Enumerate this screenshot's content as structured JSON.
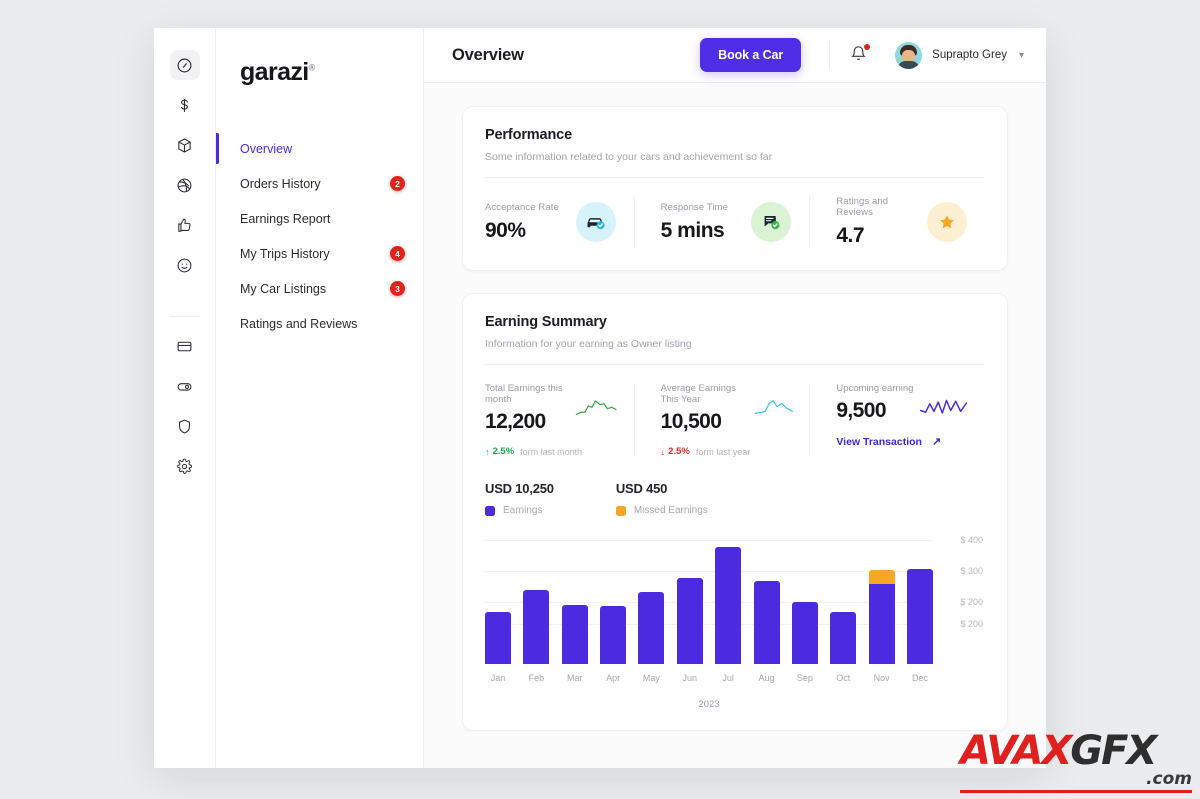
{
  "brand": {
    "name": "garazi",
    "mark": "®"
  },
  "icon_rail": {
    "items": [
      {
        "name": "dashboard-icon",
        "active": true
      },
      {
        "name": "dollar-icon",
        "active": false
      },
      {
        "name": "package-icon",
        "active": false
      },
      {
        "name": "dribbble-icon",
        "active": false
      },
      {
        "name": "thumbs-up-icon",
        "active": false
      },
      {
        "name": "smiley-icon",
        "active": false
      },
      {
        "name": "credit-card-icon",
        "active": false
      },
      {
        "name": "toggle-icon",
        "active": false
      },
      {
        "name": "shield-icon",
        "active": false
      },
      {
        "name": "gear-icon",
        "active": false
      }
    ]
  },
  "sidebar": {
    "items": [
      {
        "label": "Overview",
        "badge": "",
        "active": true
      },
      {
        "label": "Orders History",
        "badge": "2",
        "active": false
      },
      {
        "label": "Earnings Report",
        "badge": "",
        "active": false
      },
      {
        "label": "My Trips History",
        "badge": "4",
        "active": false
      },
      {
        "label": "My Car Listings",
        "badge": "3",
        "active": false
      },
      {
        "label": "Ratings and Reviews",
        "badge": "",
        "active": false
      }
    ],
    "badge_color": "#e0241c",
    "active_color": "#4b2ae0"
  },
  "topbar": {
    "title": "Overview",
    "book_button": "Book a Car",
    "book_button_color": "#4f2ee8",
    "bell_icon": "bell-icon",
    "has_notification": true,
    "user_name": "Suprapto Grey",
    "caret": "⌄"
  },
  "performance": {
    "title": "Performance",
    "subtitle": "Some information related to your cars and achievement so far",
    "stats": [
      {
        "label": "Acceptance Rate",
        "value": "90%",
        "icon": "car-verified-icon",
        "icon_bg": "#d6f2fa",
        "icon_color": "#18202b",
        "badge_color": "#2eb6e8"
      },
      {
        "label": "Response Time",
        "value": "5 mins",
        "icon": "message-verified-icon",
        "icon_bg": "#d9f3d4",
        "icon_color": "#18202b",
        "badge_color": "#38b54a"
      },
      {
        "label": "Ratings and Reviews",
        "value": "4.7",
        "icon": "star-icon",
        "icon_bg": "#fdefd2",
        "icon_color": "#f5a623",
        "badge_color": "#f5a623"
      }
    ]
  },
  "earning_summary": {
    "title": "Earning Summary",
    "subtitle": "Information for your earning as Owner listing",
    "stats": [
      {
        "label": "Total Earnings this month",
        "value": "12,200",
        "delta": "2.5%",
        "delta_dir": "up",
        "delta_arrow": "↑",
        "delta_note": "form last month",
        "spark_color": "#3fa34d",
        "link": ""
      },
      {
        "label": "Average Earnings This Year",
        "value": "10,500",
        "delta": "2.5%",
        "delta_dir": "down",
        "delta_arrow": "↓",
        "delta_note": "form last year",
        "spark_color": "#35c0ea",
        "link": ""
      },
      {
        "label": "Upcoming earning",
        "value": "9,500",
        "delta": "",
        "delta_dir": "",
        "delta_arrow": "",
        "delta_note": "",
        "spark_color": "#4b2ae0",
        "link": "View Transaction",
        "link_arrow": "↗"
      }
    ]
  },
  "chart_data": {
    "type": "bar",
    "title": "",
    "xlabel": "2023",
    "ylabel": "",
    "grid": true,
    "legend_position": "top-left",
    "categories": [
      "Jan",
      "Feb",
      "Mar",
      "Apr",
      "May",
      "Jun",
      "Jul",
      "Aug",
      "Sep",
      "Oct",
      "Nov",
      "Dec"
    ],
    "series": [
      {
        "name": "Earnings",
        "color": "#4b2ae0",
        "total_label": "USD 10,250",
        "values": [
          168,
          238,
          190,
          189,
          232,
          278,
          378,
          268,
          200,
          168,
          258,
          308
        ]
      },
      {
        "name": "Missed Earnings",
        "color": "#f7a726",
        "total_label": "USD 450",
        "values": [
          0,
          0,
          0,
          0,
          0,
          0,
          0,
          0,
          0,
          0,
          46,
          0
        ]
      }
    ],
    "ytick_labels": [
      "$ 400",
      "$ 300",
      "$ 200",
      "$ 200"
    ],
    "ytick_values": [
      400,
      300,
      200,
      130
    ],
    "ylim": [
      0,
      420
    ]
  },
  "watermark": {
    "part1": "AVAX",
    "part2": "GFX",
    "domain": ".com"
  }
}
